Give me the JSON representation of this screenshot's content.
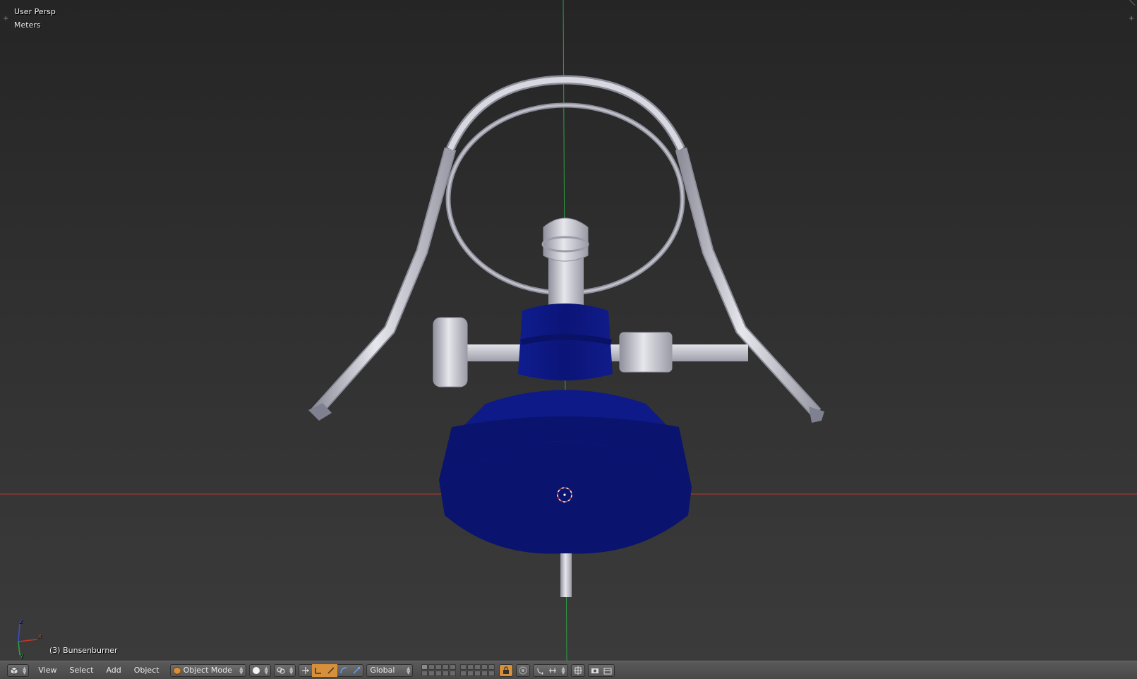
{
  "viewport": {
    "view_name": "User Persp",
    "units": "Meters",
    "object_label": "(3) Bunsenburner",
    "axes": {
      "x_label": "x",
      "y_label": "y",
      "z_label": "z"
    }
  },
  "header": {
    "editor_icon": "3d-view-icon",
    "menus": {
      "view": "View",
      "select": "Select",
      "add": "Add",
      "object": "Object"
    },
    "mode": {
      "icon": "object-cube-icon",
      "label": "Object Mode"
    },
    "shading_icon": "solid-sphere-icon",
    "pivot_icon": "pivot-icon",
    "manipulator_icons": [
      "manipulator-toggle-icon",
      "translate-icon",
      "rotate-icon",
      "scale-icon"
    ],
    "orientation": "Global",
    "layers": {
      "rows": 2,
      "groups": 2,
      "active": [
        0
      ]
    },
    "right_icons": [
      "lock-layer-icon",
      "proportional-edit-icon",
      "snap-icon",
      "snap-element-icon",
      "snap-target-icon",
      "render-opengl-icon",
      "render-anim-icon"
    ]
  },
  "colors": {
    "background": "#3d3d3d",
    "header": "#4f4f4f",
    "x_axis": "#c0392b",
    "z_axis": "#2ea043",
    "base_blue": "#0b1470",
    "metal": "#c3c3cc",
    "accent_orange": "#d78f3a"
  }
}
